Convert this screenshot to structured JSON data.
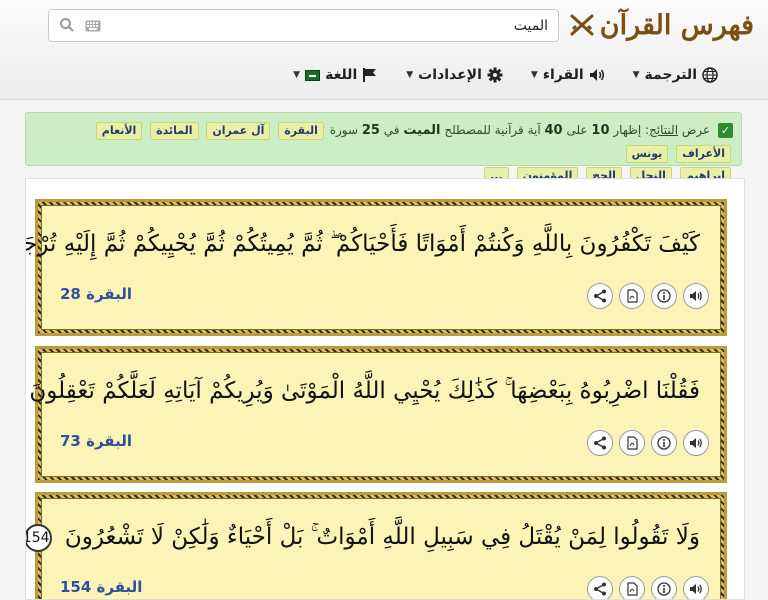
{
  "header": {
    "brand_title": "فهرس القرآن",
    "search_value": "الميت"
  },
  "menu": [
    {
      "label": "الترجمة",
      "icon": "globe-icon"
    },
    {
      "label": "القراء",
      "icon": "speaker-icon"
    },
    {
      "label": "الإعدادات",
      "icon": "gear-icon"
    },
    {
      "label": "اللغة",
      "icon": "flag-icon"
    }
  ],
  "notice": {
    "prefix": "عرض",
    "results_link": "النتائج",
    "part1": ": إظهار",
    "shown": "10",
    "part2": "على",
    "total": "40",
    "part3": "آية قرآنية للمصطلح",
    "term": "الميت",
    "part4": "في",
    "surah_count": "25",
    "part5": "سورة",
    "surahs": [
      "البقرة",
      "آل عمران",
      "المائدة",
      "الأنعام",
      "الأعراف",
      "يونس",
      "ابراهيم",
      "النحل",
      "الحج",
      "المؤمنون",
      "..."
    ]
  },
  "verses": [
    {
      "text": "كَيْفَ تَكْفُرُونَ بِاللَّهِ وَكُنتُمْ أَمْوَاتًا فَأَحْيَاكُمْ ۖ ثُمَّ يُمِيتُكُمْ ثُمَّ يُحْيِيكُمْ ثُمَّ إِلَيْهِ تُرْجَعُونَ",
      "number": "28",
      "reference": "البقرة 28"
    },
    {
      "text": "فَقُلْنَا اضْرِبُوهُ بِبَعْضِهَا ۚ كَذَٰلِكَ يُحْيِي اللَّهُ الْمَوْتَىٰ وَيُرِيكُمْ آيَاتِهِ لَعَلَّكُمْ تَعْقِلُونَ",
      "number": "73",
      "reference": "البقرة 73"
    },
    {
      "text": "وَلَا تَقُولُوا لِمَنْ يُقْتَلُ فِي سَبِيلِ اللَّهِ أَمْوَاتٌ ۚ بَلْ أَحْيَاءٌ وَلَٰكِنْ لَا تَشْعُرُونَ",
      "number": "154",
      "reference": "البقرة 154"
    }
  ]
}
